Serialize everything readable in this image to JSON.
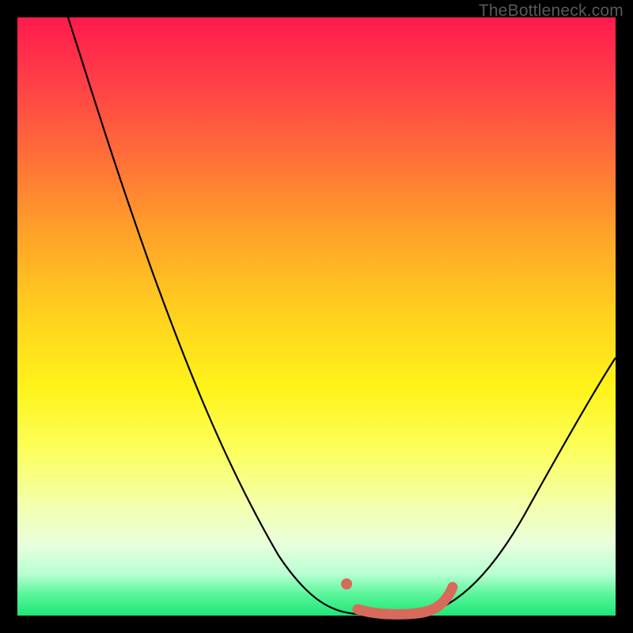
{
  "watermark": "TheBottleneck.com",
  "chart_data": {
    "type": "line",
    "title": "",
    "xlabel": "",
    "ylabel": "",
    "x": [
      0.0,
      0.05,
      0.1,
      0.15,
      0.2,
      0.25,
      0.3,
      0.35,
      0.4,
      0.45,
      0.5,
      0.55,
      0.6,
      0.65,
      0.7,
      0.75,
      0.8,
      0.85,
      0.9,
      0.95,
      1.0
    ],
    "series": [
      {
        "name": "bottleneck-curve",
        "values": [
          100,
          91,
          82,
          73,
          64,
          55,
          46,
          37,
          28,
          20,
          12,
          5,
          1,
          0,
          0,
          2,
          6,
          12,
          20,
          30,
          42
        ]
      }
    ],
    "highlight_range": {
      "x_start": 0.54,
      "x_end": 0.71
    },
    "xlim": [
      0,
      1
    ],
    "ylim": [
      0,
      100
    ],
    "legend": false,
    "grid": false,
    "annotations": []
  }
}
